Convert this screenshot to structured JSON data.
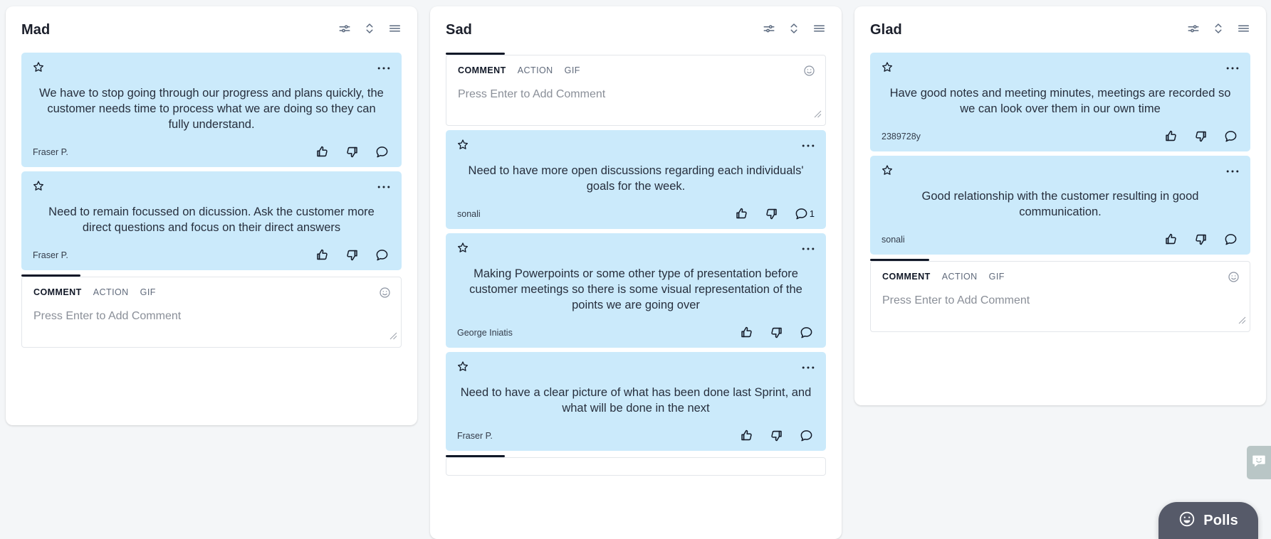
{
  "page": {
    "background": "#f4f6f8",
    "card_color": "#cbeafb",
    "accent_dark": "#111827"
  },
  "columns": [
    {
      "title": "Mad",
      "tools": [
        "filter-sliders-icon",
        "sort-updown-icon",
        "list-menu-icon"
      ],
      "cards": [
        {
          "text": "We have to stop going through our progress and plans quickly, the customer needs time to process what we are doing so they can fully understand.",
          "author": "Fraser P.",
          "like_count": "",
          "dislike_count": "",
          "comment_count": ""
        },
        {
          "text": "Need to remain focussed on dicussion. Ask the customer more direct questions and focus on their direct answers",
          "author": "Fraser P.",
          "like_count": "",
          "dislike_count": "",
          "comment_count": ""
        }
      ],
      "composer": {
        "position": "bottom",
        "tabs": [
          "COMMENT",
          "ACTION",
          "GIF"
        ],
        "active_tab": "COMMENT",
        "placeholder": "Press Enter to Add Comment",
        "emoji_icon": "smiley-icon",
        "resize_icon": "resize-grip-icon"
      }
    },
    {
      "title": "Sad",
      "tools": [
        "filter-sliders-icon",
        "sort-updown-icon",
        "list-menu-icon"
      ],
      "composer_top": {
        "tabs": [
          "COMMENT",
          "ACTION",
          "GIF"
        ],
        "active_tab": "COMMENT",
        "placeholder": "Press Enter to Add Comment",
        "emoji_icon": "smiley-icon",
        "resize_icon": "resize-grip-icon"
      },
      "cards": [
        {
          "text": "Need to have more open discussions regarding each individuals' goals for the week.",
          "author": "sonali",
          "like_count": "",
          "dislike_count": "",
          "comment_count": "1"
        },
        {
          "text": "Making Powerpoints or some other type of presentation before customer meetings so there is some visual representation of the points we are going over",
          "author": "George Iniatis",
          "like_count": "",
          "dislike_count": "",
          "comment_count": ""
        },
        {
          "text": "Need to have a clear picture of what has been done last Sprint, and what will be done in the next",
          "author": "Fraser P.",
          "like_count": "",
          "dislike_count": "",
          "comment_count": ""
        }
      ],
      "composer_bottom_clipped": true
    },
    {
      "title": "Glad",
      "tools": [
        "filter-sliders-icon",
        "sort-updown-icon",
        "list-menu-icon"
      ],
      "cards": [
        {
          "text": "Have good notes and meeting minutes, meetings are recorded so we can look over them in our own time",
          "author": "2389728y",
          "like_count": "",
          "dislike_count": "",
          "comment_count": ""
        },
        {
          "text": "Good relationship with the customer resulting in good communication.",
          "author": "sonali",
          "like_count": "",
          "dislike_count": "",
          "comment_count": ""
        }
      ],
      "composer": {
        "position": "bottom",
        "tabs": [
          "COMMENT",
          "ACTION",
          "GIF"
        ],
        "active_tab": "COMMENT",
        "placeholder": "Press Enter to Add Comment",
        "emoji_icon": "smiley-icon",
        "resize_icon": "resize-grip-icon"
      }
    }
  ],
  "floating": {
    "feedback_tab_icon": "chat-smiley-icon",
    "polls": {
      "label": "Polls",
      "icon": "smiley-face-icon",
      "background": "#565a69"
    }
  }
}
